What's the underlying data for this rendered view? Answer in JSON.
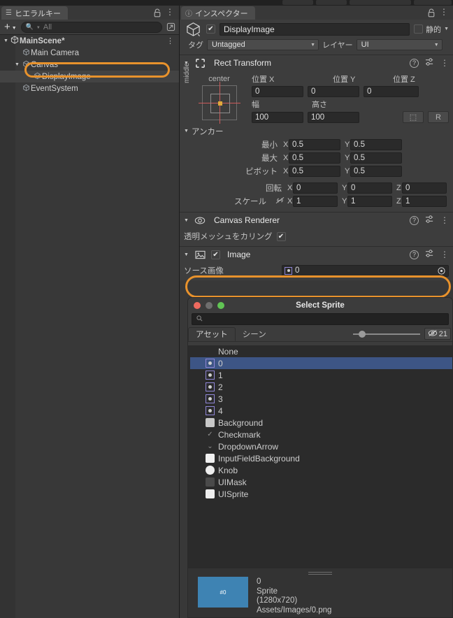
{
  "window": {
    "background": "#383838",
    "accent_orange": "#e8922c",
    "selection_blue": "#3d5585"
  },
  "hierarchy": {
    "tab_label": "ヒエラルキー",
    "tab_icon": "hierarchy-icon",
    "lock_icon": "lock-icon",
    "menu_icon": "kebab-menu-icon",
    "add_button": "+",
    "add_caret": "▼",
    "search_placeholder": "All",
    "search_value": "",
    "popout_icon": "popout-icon",
    "rows": [
      {
        "label": "MainScene*",
        "depth": 0,
        "icon": "unity-scene-icon",
        "twisty": "▼",
        "bold": true,
        "selected": false,
        "kebab": "⋮"
      },
      {
        "label": "Main Camera",
        "depth": 1,
        "icon": "gameobject-icon",
        "twisty": "",
        "bold": false,
        "selected": false,
        "kebab": ""
      },
      {
        "label": "Canvas",
        "depth": 1,
        "icon": "gameobject-icon",
        "twisty": "▼",
        "bold": false,
        "selected": false,
        "kebab": ""
      },
      {
        "label": "DisplayImage",
        "depth": 2,
        "icon": "gameobject-icon",
        "twisty": "",
        "bold": false,
        "selected": true,
        "kebab": ""
      },
      {
        "label": "EventSystem",
        "depth": 1,
        "icon": "gameobject-icon",
        "twisty": "",
        "bold": false,
        "selected": false,
        "kebab": ""
      }
    ]
  },
  "inspector": {
    "tab_label": "インスペクター",
    "tab_icon": "info-icon",
    "lock_icon": "lock-icon",
    "menu_icon": "kebab-menu-icon",
    "object_header": {
      "enabled_checkbox": "✔",
      "name": "DisplayImage",
      "static_label": "静的",
      "static_checked": false,
      "tag_label": "タグ",
      "tag_value": "Untagged",
      "layer_label": "レイヤー",
      "layer_value": "UI",
      "dropdown_caret": "▼"
    },
    "rect_transform": {
      "title": "Rect Transform",
      "fold": "▼",
      "anchor_preset_top": "center",
      "anchor_preset_side": "middle",
      "pos_x_label": "位置 X",
      "pos_y_label": "位置 Y",
      "pos_z_label": "位置 Z",
      "pos_x": "0",
      "pos_y": "0",
      "pos_z": "0",
      "width_label": "幅",
      "height_label": "高さ",
      "width": "100",
      "height": "100",
      "blueprint_button": "⬚",
      "raw_button": "R",
      "anchors_label": "アンカー",
      "anchors_fold": "▼",
      "min_label": "最小",
      "max_label": "最大",
      "pivot_label": "ピボット",
      "min_x": "0.5",
      "min_y": "0.5",
      "max_x": "0.5",
      "max_y": "0.5",
      "pivot_x": "0.5",
      "pivot_y": "0.5",
      "rotation_label": "回転",
      "rot_x": "0",
      "rot_y": "0",
      "rot_z": "0",
      "scale_label": "スケール",
      "scale_link_icon": "link-broken-icon",
      "scale_x": "1",
      "scale_y": "1",
      "scale_z": "1",
      "axis_x": "X",
      "axis_y": "Y",
      "axis_z": "Z",
      "help_icon": "help-icon",
      "preset_icon": "preset-icon",
      "more_icon": "kebab-menu-icon"
    },
    "canvas_renderer": {
      "title": "Canvas Renderer",
      "fold": "▼",
      "icon": "eye-icon",
      "cull_label": "透明メッシュをカリング",
      "cull_checked": true,
      "checkmark": "✔"
    },
    "image": {
      "title": "Image",
      "fold": "▼",
      "icon": "image-component-icon",
      "enabled_checkbox": "✔",
      "source_label": "ソース画像",
      "source_value": "0",
      "source_sprite_icon": "sprite-icon",
      "picker_icon": "object-picker-icon"
    }
  },
  "select_sprite_dialog": {
    "title": "Select Sprite",
    "close_color": "#ee6a5f",
    "minimize_color": "#6e6e6e",
    "maximize_color": "#61c454",
    "search_placeholder": "",
    "search_value": "",
    "search_icon": "search-icon",
    "tabs": [
      {
        "label": "アセット",
        "active": true
      },
      {
        "label": "シーン",
        "active": false
      }
    ],
    "visibility_icon": "eye-off-icon",
    "visibility_count": "21",
    "items": [
      {
        "label": "None",
        "icon": "none",
        "color": "",
        "selected": false
      },
      {
        "label": "0",
        "icon": "sprite",
        "color": "",
        "selected": true
      },
      {
        "label": "1",
        "icon": "sprite",
        "color": "",
        "selected": false
      },
      {
        "label": "2",
        "icon": "sprite",
        "color": "",
        "selected": false
      },
      {
        "label": "3",
        "icon": "sprite",
        "color": "",
        "selected": false
      },
      {
        "label": "4",
        "icon": "sprite",
        "color": "",
        "selected": false
      },
      {
        "label": "Background",
        "icon": "square",
        "color": "#c8c8c8",
        "selected": false
      },
      {
        "label": "Checkmark",
        "icon": "check",
        "color": "",
        "selected": false
      },
      {
        "label": "DropdownArrow",
        "icon": "chevron",
        "color": "",
        "selected": false
      },
      {
        "label": "InputFieldBackground",
        "icon": "square",
        "color": "#f0f0f0",
        "selected": false
      },
      {
        "label": "Knob",
        "icon": "circle",
        "color": "#ededed",
        "selected": false
      },
      {
        "label": "UIMask",
        "icon": "square",
        "color": "#4a4a4a",
        "selected": false
      },
      {
        "label": "UISprite",
        "icon": "square",
        "color": "#eeeeee",
        "selected": false
      }
    ],
    "preview": {
      "name": "0",
      "type": "Sprite",
      "dimensions": "(1280x720)",
      "path": "Assets/Images/0.png",
      "thumb_color": "#3e83b3",
      "thumb_label": "#0"
    }
  }
}
